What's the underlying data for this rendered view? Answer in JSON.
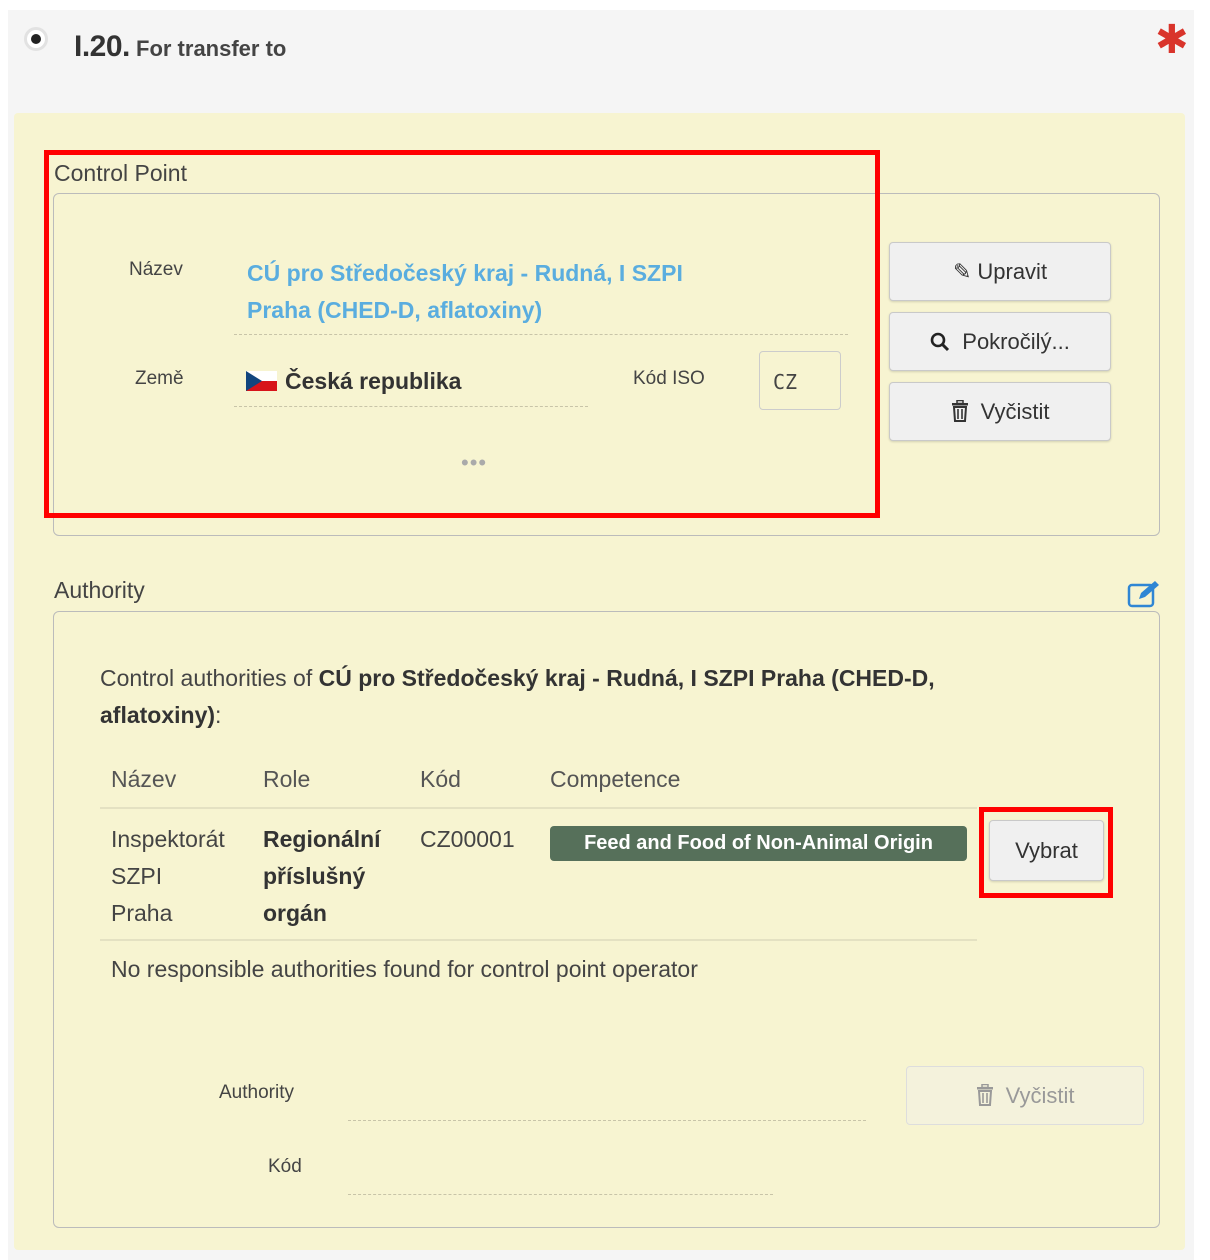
{
  "section": {
    "number": "I.20.",
    "title": "For transfer to",
    "required_mark": "✱"
  },
  "control_point": {
    "legend": "Control Point",
    "name_label": "Název",
    "name_line1": "CÚ pro Středočeský kraj - Rudná, I SZPI",
    "name_line2": "Praha (CHED-D, aflatoxiny)",
    "country_label": "Země",
    "country_value": "Česká republika",
    "iso_label": "Kód ISO",
    "iso_value": "CZ",
    "more": "•••",
    "buttons": {
      "edit": "Upravit",
      "advanced": "Pokročilý...",
      "clear": "Vyčistit"
    }
  },
  "authority": {
    "legend": "Authority",
    "intro_prefix": "Control authorities of ",
    "intro_name_line1": "CÚ pro Středočeský kraj - Rudná, I SZPI Praha (CHED-D,",
    "intro_name_line2": "aflatoxiny)",
    "intro_suffix": ":",
    "columns": [
      "Název",
      "Role",
      "Kód",
      "Competence"
    ],
    "row": {
      "name": [
        "Inspektorát",
        "SZPI",
        "Praha"
      ],
      "role": [
        "Regionální",
        "příslušný",
        "orgán"
      ],
      "code": "CZ00001",
      "competence": "Feed and Food of Non-Animal Origin",
      "select": "Vybrat"
    },
    "no_results": "No responsible authorities found for control point operator",
    "field_authority_label": "Authority",
    "field_code_label": "Kód",
    "clear": "Vyčistit"
  },
  "colors": {
    "link": "#5aaddf",
    "badge": "#56705a",
    "highlight": "#ff0000",
    "required": "#d9342b",
    "panel_bg": "#f7f4d1"
  }
}
